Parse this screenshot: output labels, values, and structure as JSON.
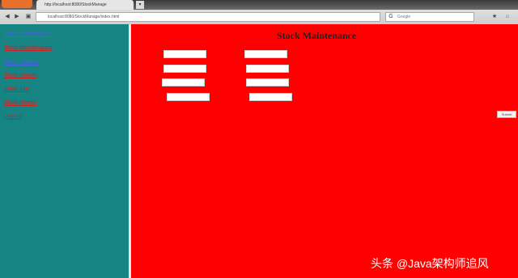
{
  "browser": {
    "tab_title": "http://localhost:8080/StockManage",
    "tab_arrow": "▾",
    "url": "localhost:8080/StockManage/index.html",
    "search_placeholder": "Google",
    "back": "◀",
    "forward": "▶",
    "url_icon": "▣",
    "search_icon": "G",
    "bookmark": "★",
    "home": "⌂"
  },
  "sidebar": {
    "items": [
      {
        "label": "Stock Maintenance",
        "color": "#4466dd"
      },
      {
        "label": "Stock Maintenance",
        "color": "#cc2222"
      },
      {
        "label": "Stock Update",
        "color": "#4466dd"
      },
      {
        "label": "Stock Details",
        "color": "#cc2222"
      },
      {
        "label": "Stock List",
        "color": "#cc2222"
      },
      {
        "label": "Stock Report",
        "color": "#cc2222"
      },
      {
        "label": "Logout",
        "color": "#cc2222"
      }
    ]
  },
  "main": {
    "title": "Stock Maintenance",
    "button_label": "Submit",
    "fields": [
      "",
      "",
      "",
      "",
      "",
      "",
      "",
      ""
    ]
  },
  "watermark": "头条 @Java架构师追风"
}
